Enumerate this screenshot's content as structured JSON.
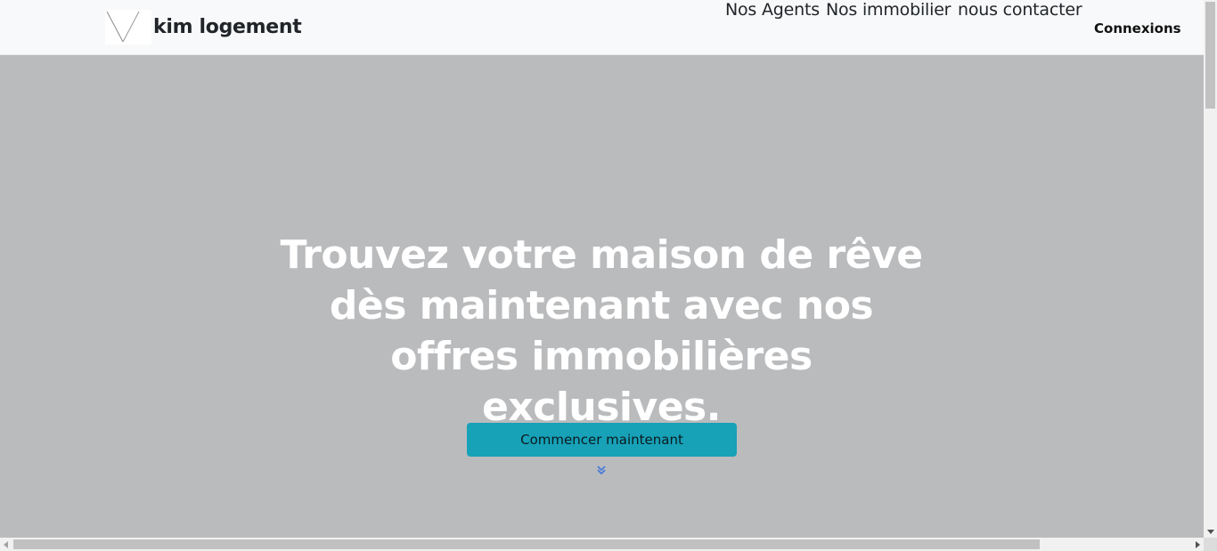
{
  "navbar": {
    "brand_name": "kim logement",
    "links": [
      "Nos Agents",
      "Nos immobilier",
      "nous contacter"
    ],
    "login_label": "Connexions",
    "logo_icon": "logo-icon"
  },
  "hero": {
    "title": "Trouvez votre maison de rêve dès maintenant avec nos offres immobilières exclusives.",
    "cta_label": "Commencer maintenant",
    "scroll_icon": "double-chevron-down-icon",
    "background_color": "#babbbd",
    "cta_color": "#17a2b8",
    "chevron_color": "#4a7bd9"
  }
}
